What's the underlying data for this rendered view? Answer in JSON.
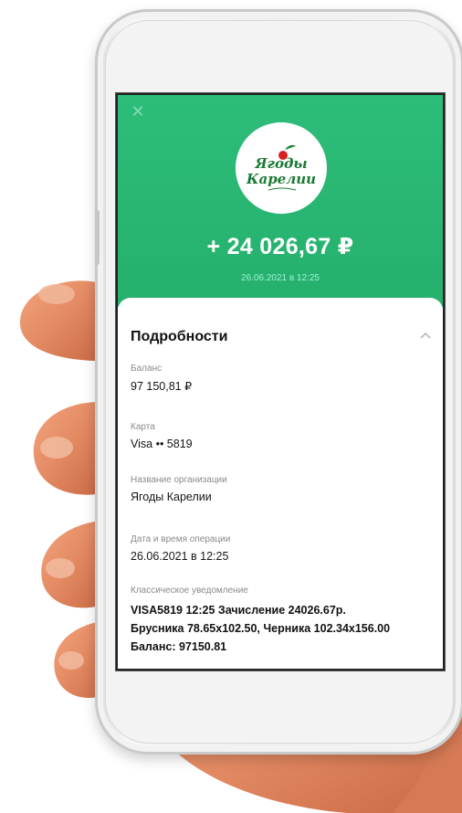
{
  "header": {
    "merchant_logo_text": "Ягоды Карелии",
    "amount": "+ 24 026,67 ₽",
    "datetime": "26.06.2021 в 12:25",
    "accent_color": "#2dbd7a"
  },
  "details": {
    "title": "Подробности",
    "fields": [
      {
        "label": "Баланс",
        "value": "97 150,81 ₽"
      },
      {
        "label": "Карта",
        "value": "Visa •• 5819"
      },
      {
        "label": "Название организации",
        "value": "Ягоды Карелии"
      },
      {
        "label": "Дата и время операции",
        "value": "26.06.2021 в 12:25"
      }
    ],
    "notification": {
      "label": "Классическое уведомление",
      "text": "VISA5819 12:25 Зачисление 24026.67р.\nБрусника 78.65x102.50, Черника 102.34x156.00\nБаланс: 97150.81"
    }
  },
  "icons": {
    "close": "close-icon",
    "collapse": "chevron-up-icon"
  }
}
